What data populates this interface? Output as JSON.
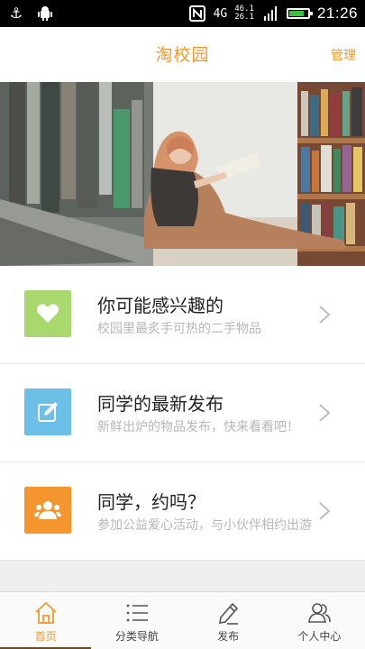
{
  "status_bar": {
    "time": "21:26",
    "network": "4G",
    "speed_up": "46.1",
    "speed_down": "26.1",
    "battery_percent": 80
  },
  "header": {
    "title": "淘校园",
    "manage_label": "管理"
  },
  "banner": {
    "image": "library-reading-photo"
  },
  "cards": [
    {
      "title": "你可能感兴趣的",
      "subtitle": "校园里最炙手可热的二手物品",
      "icon": "heart-icon",
      "color": "#a9d86e"
    },
    {
      "title": "同学的最新发布",
      "subtitle": "新鲜出炉的物品发布，快来看看吧！",
      "icon": "edit-icon",
      "color": "#6cc0e8"
    },
    {
      "title": "同学，约吗？",
      "subtitle": "参加公益爱心活动，与小伙伴相约出游",
      "icon": "group-icon",
      "color": "#f5952e"
    }
  ],
  "tabs": [
    {
      "label": "首页",
      "icon": "home-icon",
      "active": true
    },
    {
      "label": "分类导航",
      "icon": "list-icon",
      "active": false
    },
    {
      "label": "发布",
      "icon": "pen-icon",
      "active": false
    },
    {
      "label": "个人中心",
      "icon": "user-group-icon",
      "active": false
    }
  ],
  "colors": {
    "accent": "#f39a2b",
    "tab_underline": "#6a4a2a"
  }
}
